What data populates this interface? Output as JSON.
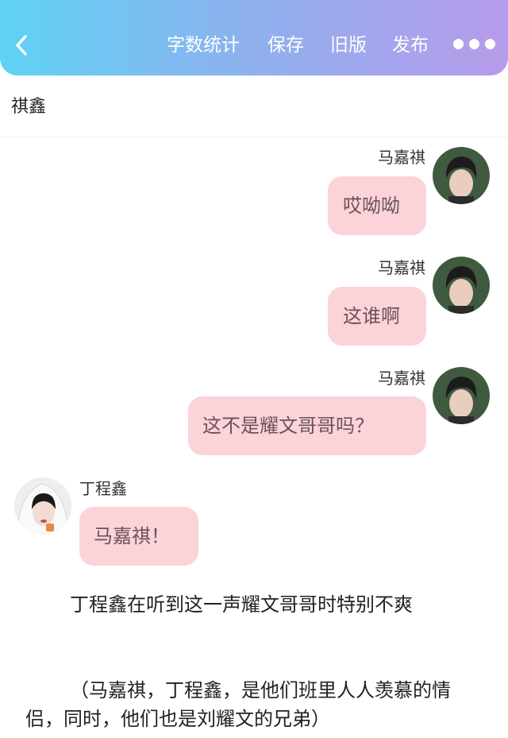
{
  "header": {
    "back_icon": "chevron-left-icon",
    "word_count_label": "字数统计",
    "save_label": "保存",
    "old_version_label": "旧版",
    "publish_label": "发布",
    "more_icon": "more-horizontal-icon"
  },
  "doc": {
    "title": "祺鑫"
  },
  "messages": [
    {
      "sender": "马嘉祺",
      "text": "哎呦呦",
      "side": "right"
    },
    {
      "sender": "马嘉祺",
      "text": "这谁啊",
      "side": "right"
    },
    {
      "sender": "马嘉祺",
      "text": "这不是耀文哥哥吗？",
      "side": "right"
    },
    {
      "sender": "丁程鑫",
      "text": "马嘉祺！",
      "side": "left"
    }
  ],
  "paragraphs": [
    "丁程鑫在听到这一声耀文哥哥时特别不爽",
    "（马嘉祺，丁程鑫，是他们班里人人羡慕的情侣，同时，他们也是刘耀文的兄弟）"
  ],
  "colors": {
    "header_gradient_start": "#5fd2f4",
    "header_gradient_end": "#b79bea",
    "bubble_bg": "#fbd3d9",
    "bubble_text": "#6a5258"
  }
}
